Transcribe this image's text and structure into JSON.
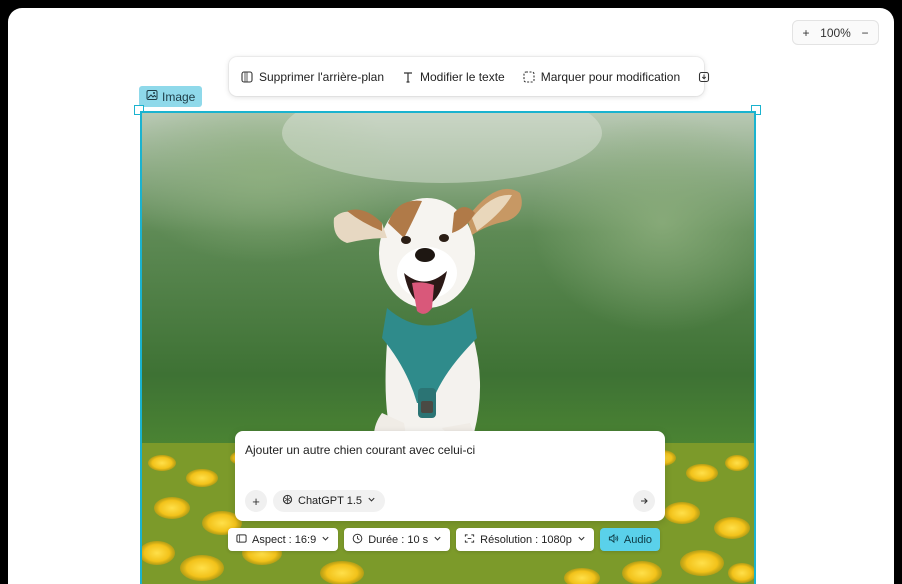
{
  "zoom": {
    "level": "100%",
    "plus": "+",
    "minus": "−"
  },
  "toolbar": {
    "remove_bg": "Supprimer l'arrière-plan",
    "edit_text": "Modifier le texte",
    "mark_edit": "Marquer pour modification"
  },
  "tag": {
    "label": "Image"
  },
  "prompt": {
    "text": "Ajouter un autre chien courant avec celui-ci",
    "add": "+",
    "model": "ChatGPT 1.5"
  },
  "chips": {
    "aspect": "Aspect : 16:9",
    "duration": "Durée : 10 s",
    "resolution": "Résolution : 1080p",
    "audio": "Audio"
  },
  "colors": {
    "accent": "#1ab3cf",
    "tag_bg": "#8fd9ea",
    "audio_bg": "#5ad1ea"
  }
}
